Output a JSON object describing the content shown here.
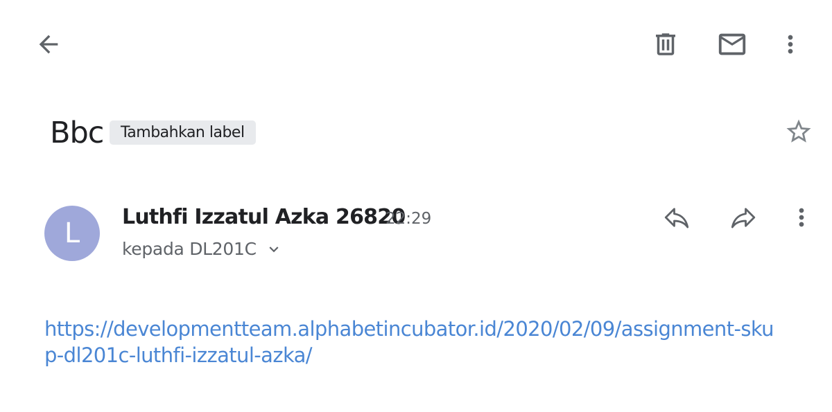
{
  "toolbar": {
    "back_icon": "arrow-back-icon",
    "delete_icon": "trash-icon",
    "mark_unread_icon": "mail-icon",
    "more_icon": "more-vert-icon"
  },
  "subject": {
    "title": "Bbc",
    "label_chip": "Tambahkan label",
    "star_icon": "star-outline-icon"
  },
  "message": {
    "avatar_initial": "L",
    "avatar_color": "#9fa8da",
    "sender_name": "Luthfi Izzatul Azka 26820",
    "time": "22:29",
    "recipient": "kepada DL201C",
    "reply_icon": "reply-icon",
    "forward_icon": "forward-icon",
    "more_icon": "more-vert-icon"
  },
  "body": {
    "link_text": "https://developmentteam.alphabetincubator.id/2020/02/09/assignment-skup-dl201c-luthfi-izzatul-azka/",
    "link_color": "#4a86d4"
  }
}
